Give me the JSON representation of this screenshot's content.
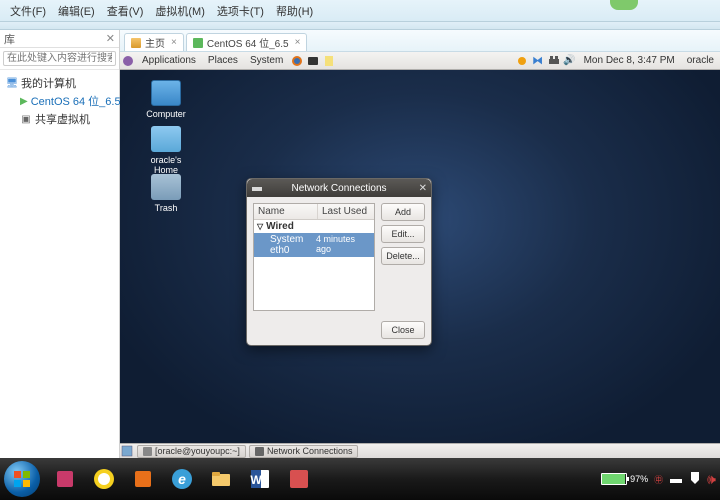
{
  "host": {
    "menu": {
      "file": "文件(F)",
      "edit": "编辑(E)",
      "view": "查看(V)",
      "vm": "虚拟机(M)",
      "tabs": "选项卡(T)",
      "help": "帮助(H)"
    },
    "library": {
      "title": "库",
      "search_placeholder": "在此处键入内容进行搜索",
      "root": "我的计算机",
      "items": [
        {
          "label": "CentOS 64 位_6.5",
          "running": true
        },
        {
          "label": "共享虚拟机",
          "running": false
        }
      ]
    },
    "tabs": {
      "home": "主页",
      "vm": "CentOS 64 位_6.5"
    }
  },
  "gnome": {
    "top": {
      "apps": "Applications",
      "places": "Places",
      "system": "System",
      "date": "Mon Dec  8,  3:47 PM",
      "user": "oracle"
    },
    "desktop": {
      "computer": "Computer",
      "home": "oracle's Home",
      "trash": "Trash"
    },
    "bottom": {
      "term": "[oracle@youyoupc:~]",
      "net": "Network Connections"
    }
  },
  "dialog": {
    "title": "Network Connections",
    "cols": {
      "name": "Name",
      "last": "Last Used"
    },
    "group": "Wired",
    "row": {
      "name": "System eth0",
      "last": "4 minutes ago"
    },
    "buttons": {
      "add": "Add",
      "edit": "Edit...",
      "del": "Delete...",
      "close": "Close"
    }
  },
  "win": {
    "battery_pct": "97%",
    "battery_fill": 97
  }
}
